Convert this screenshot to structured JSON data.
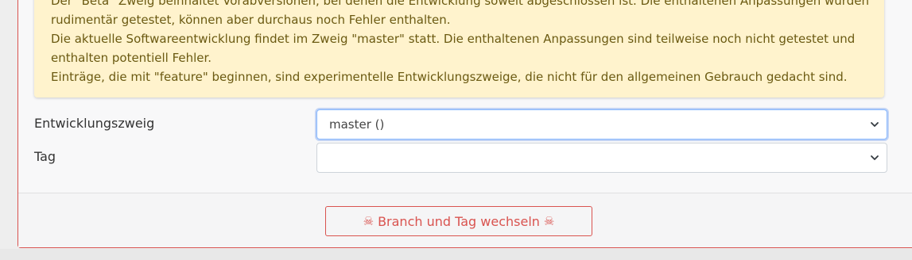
{
  "alert": {
    "lines": [
      "Der \"Beta\" Zweig beinhaltet Vorabversionen, bei denen die Entwicklung soweit abgeschlossen ist. Die enthaltenen Anpassungen wurden",
      "rudimentär getestet, können aber durchaus noch Fehler enthalten.",
      "Die aktuelle Softwareentwicklung findet im Zweig \"master\" statt. Die enthaltenen Anpassungen sind teilweise noch nicht getestet und",
      "enthalten potentiell Fehler.",
      "Einträge, die mit \"feature\" beginnen, sind experimentelle Entwicklungszweige, die nicht für den allgemeinen Gebrauch gedacht sind."
    ]
  },
  "form": {
    "branch": {
      "label": "Entwicklungszweig",
      "value": "master ()"
    },
    "tag": {
      "label": "Tag",
      "value": ""
    }
  },
  "footer": {
    "button_label": "Branch und Tag wechseln",
    "button_icon": "skull-crossbones-icon"
  },
  "colors": {
    "danger": "#d9534f",
    "alert_bg": "#fff3cd",
    "alert_text": "#6b5a12",
    "focus": "#86b7fe"
  }
}
